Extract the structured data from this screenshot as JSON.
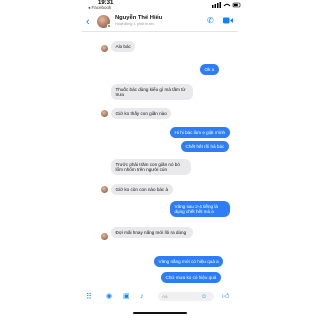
{
  "status_bar": {
    "time": "19:31",
    "back_label": "◂ Facebook"
  },
  "header": {
    "contact_name": "Nguyễn Thế Hiếu",
    "presence": "Hoạt động 1 phút trước"
  },
  "messages": [
    {
      "dir": "in",
      "text": "Alo bác"
    },
    {
      "dir": "out",
      "text": "Ok a"
    },
    {
      "dir": "in",
      "text": "Thuốc bác dùng kiểu gì mà tầm từ trưa"
    },
    {
      "dir": "in",
      "text": "Giờ ko thấy con giãn nào"
    },
    {
      "dir": "out",
      "text": "Hi hi bác làm e giật mình"
    },
    {
      "dir": "out",
      "text": "Chết hết rồi hả bác"
    },
    {
      "dir": "in",
      "text": "Trước phải trăm con giãn nó bò lổm nhổm trên người cún"
    },
    {
      "dir": "in",
      "text": "Giờ ko còn con nào bác à"
    },
    {
      "dir": "out",
      "text": "Vâng sau 2-4 tiếng là dụng chết hết mà a"
    },
    {
      "dir": "in",
      "text": "Đợi mãi hnay nắng mới lôi ra dùng"
    },
    {
      "dir": "out",
      "text": "Vâng nắng mới có hiệu quả a"
    },
    {
      "dir": "out",
      "text": "Chứ mưa ko có hiệu quả"
    }
  ],
  "composer": {
    "placeholder": "Aa"
  },
  "colors": {
    "outgoing": "#2d7df6",
    "incoming": "#e9e9eb",
    "accent": "#0a84ff"
  },
  "icons": [
    "back-arrow-icon",
    "phone-icon",
    "video-icon",
    "menu-icon",
    "camera-icon",
    "image-icon",
    "mic-icon",
    "emoji-icon",
    "like-icon"
  ]
}
